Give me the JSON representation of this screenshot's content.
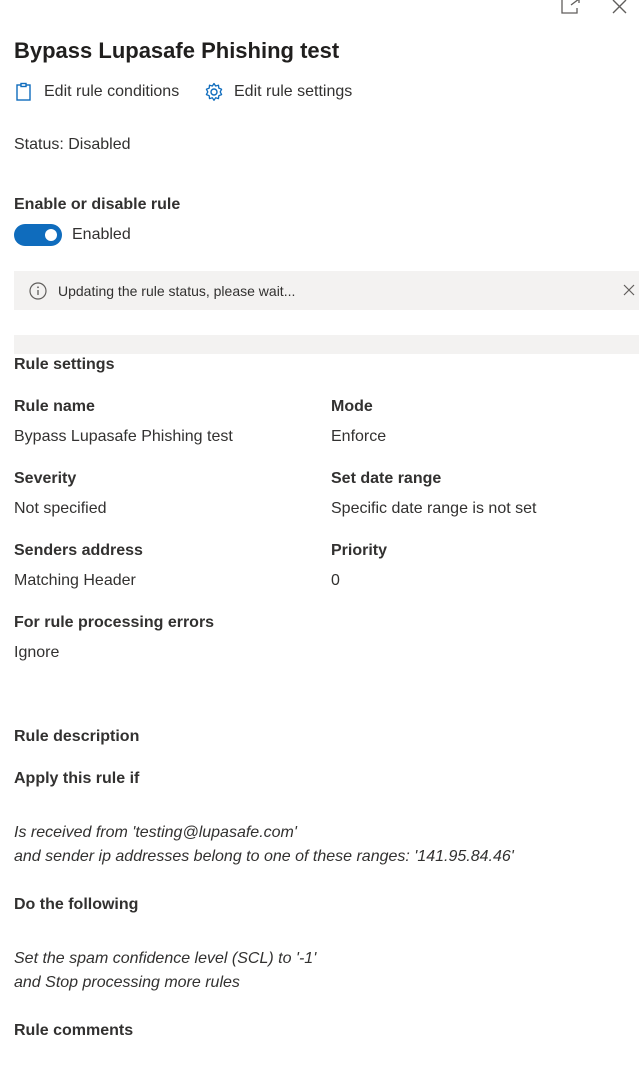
{
  "panel": {
    "title": "Bypass Lupasafe Phishing test",
    "top_icons": [
      "open-in-new-window-icon",
      "close-icon"
    ]
  },
  "commands": {
    "edit_conditions": "Edit rule conditions",
    "edit_settings": "Edit rule settings"
  },
  "status": "Status: Disabled",
  "toggle_section": {
    "label": "Enable or disable rule",
    "state_text": "Enabled",
    "is_on": true
  },
  "message_bar": {
    "text": "Updating the rule status, please wait..."
  },
  "settings": {
    "heading": "Rule settings",
    "fields": [
      {
        "label": "Rule name",
        "value": "Bypass Lupasafe Phishing test"
      },
      {
        "label": "Mode",
        "value": "Enforce"
      },
      {
        "label": "Severity",
        "value": "Not specified"
      },
      {
        "label": "Set date range",
        "value": "Specific date range is not set"
      },
      {
        "label": "Senders address",
        "value": "Matching Header"
      },
      {
        "label": "Priority",
        "value": "0"
      },
      {
        "label": "For rule processing errors",
        "value": "Ignore"
      }
    ]
  },
  "description": {
    "heading": "Rule description",
    "apply_if_heading": "Apply this rule if",
    "conditions": [
      "Is received from 'testing@lupasafe.com'",
      "and sender ip addresses belong to one of these ranges: '141.95.84.46'"
    ],
    "do_following_heading": "Do the following",
    "actions": [
      "Set the spam confidence level (SCL) to '-1'",
      "and Stop processing more rules"
    ],
    "comments_heading": "Rule comments"
  },
  "colors": {
    "accent": "#0f6cbd",
    "message_bar_bg": "#f3f2f1",
    "text": "#323130"
  }
}
